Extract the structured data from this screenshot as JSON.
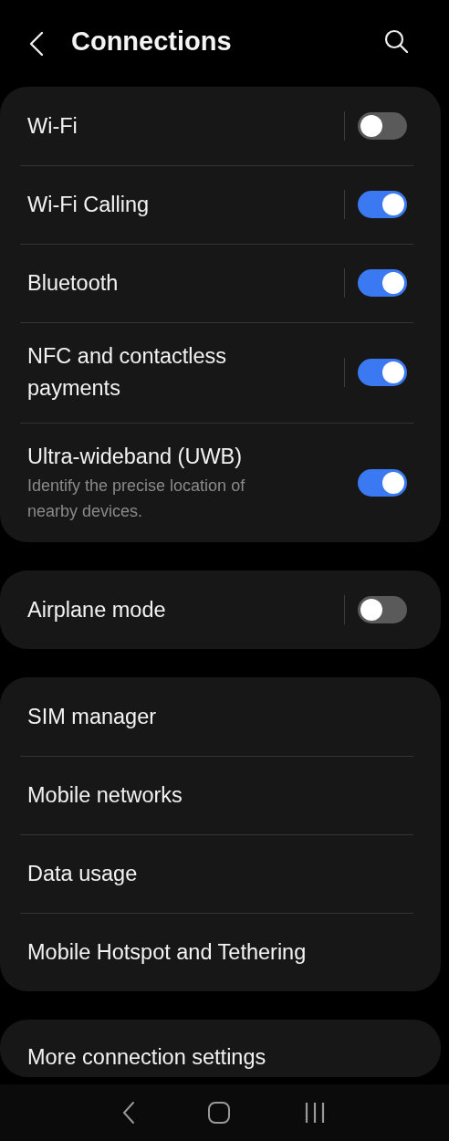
{
  "header": {
    "title": "Connections"
  },
  "groups": [
    {
      "items": [
        {
          "kind": "toggle",
          "label": "Wi-Fi",
          "on": false
        },
        {
          "kind": "toggle",
          "label": "Wi-Fi Calling",
          "on": true
        },
        {
          "kind": "toggle",
          "label": "Bluetooth",
          "on": true
        },
        {
          "kind": "toggle",
          "label": "NFC and contactless payments",
          "on": true
        },
        {
          "kind": "toggle",
          "label": "Ultra-wideband (UWB)",
          "description": "Identify the precise location of nearby devices.",
          "on": true
        }
      ]
    },
    {
      "items": [
        {
          "kind": "toggle",
          "label": "Airplane mode",
          "on": false
        }
      ]
    },
    {
      "items": [
        {
          "kind": "link",
          "label": "SIM manager"
        },
        {
          "kind": "link",
          "label": "Mobile networks"
        },
        {
          "kind": "link",
          "label": "Data usage"
        },
        {
          "kind": "link",
          "label": "Mobile Hotspot and Tethering"
        }
      ]
    },
    {
      "items": [
        {
          "kind": "link",
          "label": "More connection settings"
        }
      ]
    }
  ]
}
